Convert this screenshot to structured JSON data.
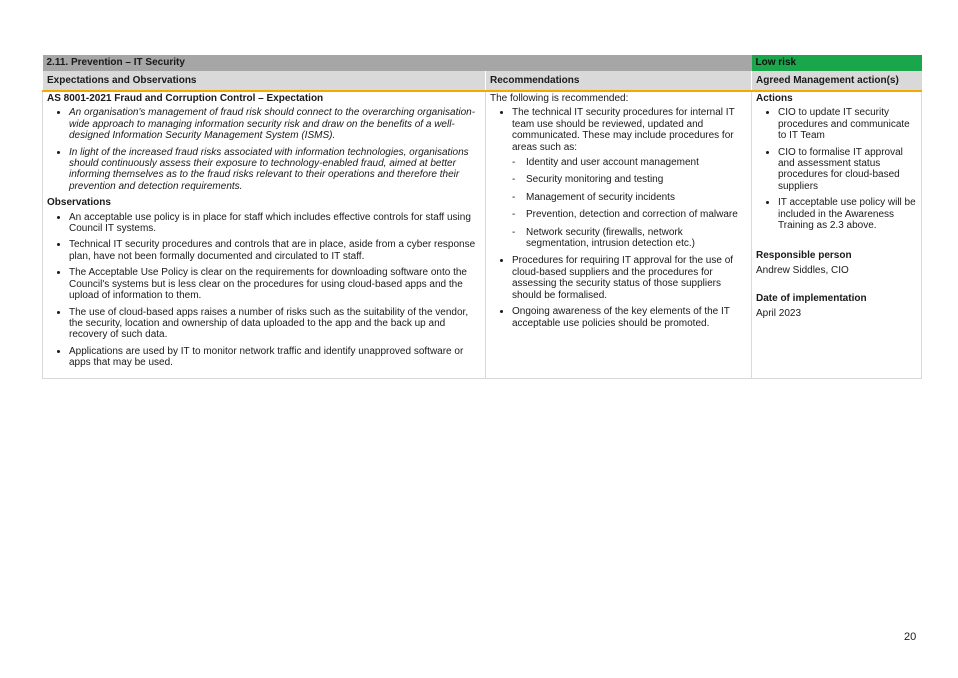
{
  "table": {
    "title": "2.11. Prevention – IT Security",
    "risk_badge": "Low risk",
    "colors": {
      "title_bar": "#a6a6a6",
      "risk": "#1aa64b",
      "header_bg": "#d9d9d9",
      "header_rule": "#f5a800"
    },
    "headers": {
      "expectations": "Expectations and Observations",
      "recommendations": "Recommendations",
      "actions": "Agreed Management action(s)"
    },
    "expectations": {
      "heading": "AS 8001-2021 Fraud and Corruption Control – Expectation",
      "items": [
        "An organisation's management of fraud risk should connect to the overarching organisation-wide approach to managing information security risk and draw on the benefits of a well-designed Information Security Management System (ISMS).",
        "In light of the increased fraud risks associated with information technologies, organisations should continuously assess their exposure to technology-enabled fraud, aimed at better informing themselves as to the fraud risks relevant to their operations and therefore their prevention and detection requirements."
      ],
      "observations_heading": "Observations",
      "observations": [
        "An acceptable use policy is in place for staff which includes effective controls for staff using Council IT systems.",
        "Technical IT security procedures and controls that are in place, aside from a cyber response plan, have not been formally documented and circulated to IT staff.",
        "The Acceptable Use Policy is clear on the requirements for downloading software onto the Council's systems but is less clear on the procedures for using cloud-based apps and the upload of information to them.",
        "The use of cloud-based apps raises a number of risks such as the suitability of the vendor, the security, location and ownership of data uploaded to the app and the back up and recovery of such data.",
        "Applications are used by IT to monitor network traffic and identify unapproved software or apps that may be used."
      ]
    },
    "recommendations": {
      "intro": "The following is recommended:",
      "item1": "The technical IT security procedures for internal IT team use should be reviewed, updated and communicated. These may include procedures for areas such as:",
      "areas": [
        "Identity and user account management",
        "Security monitoring and testing",
        "Management of security incidents",
        "Prevention, detection and correction of malware",
        "Network security (firewalls, network segmentation, intrusion detection etc.)"
      ],
      "item2": "Procedures for requiring IT approval for the use of cloud-based suppliers and the procedures for assessing the security status of those suppliers should be formalised.",
      "item3": "Ongoing awareness of the key elements of the IT acceptable use policies should be promoted."
    },
    "actions": {
      "heading": "Actions",
      "items": [
        "CIO to update IT security procedures and communicate to IT Team",
        "CIO to formalise IT approval and assessment status procedures for cloud-based suppliers",
        "IT acceptable use policy will be included in the Awareness Training as 2.3 above."
      ],
      "responsible_label": "Responsible person",
      "responsible": "Andrew Siddles, CIO",
      "date_label": "Date of implementation",
      "date": "April 2023"
    }
  },
  "page_number": "20"
}
